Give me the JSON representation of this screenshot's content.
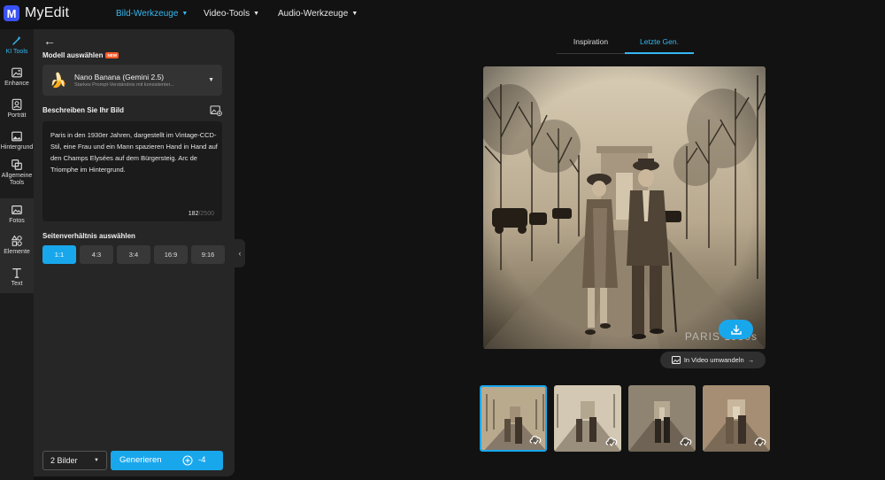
{
  "app": {
    "name": "MyEdit"
  },
  "top_nav": [
    {
      "label": "Bild-Werkzeuge",
      "active": true
    },
    {
      "label": "Video-Tools",
      "active": false
    },
    {
      "label": "Audio-Werkzeuge",
      "active": false
    }
  ],
  "rail": {
    "items": [
      {
        "label": "KI Tools",
        "icon": "magic-wand-icon",
        "active": true
      },
      {
        "label": "Enhance",
        "icon": "enhance-icon"
      },
      {
        "label": "Porträt",
        "icon": "portrait-icon"
      },
      {
        "label": "Hintergrund",
        "icon": "background-icon"
      },
      {
        "label": "Allgemeine Tools",
        "icon": "general-tools-icon"
      },
      {
        "label": "Fotos",
        "icon": "photos-icon"
      },
      {
        "label": "Elemente",
        "icon": "elements-icon"
      },
      {
        "label": "Text",
        "icon": "text-icon"
      }
    ]
  },
  "panel": {
    "model_heading": "Modell auswählen",
    "new_badge": "NEW",
    "model": {
      "name": "Nano Banana (Gemini 2.5)",
      "description": "Starkes Prompt-Verständnis mit konsistenter..."
    },
    "prompt_heading": "Beschreiben Sie Ihr Bild",
    "prompt_text": "Paris in den 1930er Jahren, dargestellt im Vintage-CCD-Stil, eine Frau und ein Mann spazieren Hand in Hand auf den Champs Elysées auf dem Bürgersteig. Arc de Triomphe im Hintergrund.",
    "char_count": "182",
    "char_max": "/2500",
    "ratio_heading": "Seitenverhältnis auswählen",
    "ratios": [
      {
        "label": "1:1",
        "active": true
      },
      {
        "label": "4:3"
      },
      {
        "label": "3:4"
      },
      {
        "label": "16:9"
      },
      {
        "label": "9:16"
      }
    ],
    "image_count": "2 Bilder",
    "generate_label": "Generieren",
    "credit_cost": "-4"
  },
  "main": {
    "tabs": [
      {
        "label": "Inspiration",
        "active": false
      },
      {
        "label": "Letzte Gen.",
        "active": true
      }
    ],
    "image_watermark": "PARIS 1930s",
    "video_button": "In Video umwandeln",
    "thumbnails": 4,
    "selected_thumbnail": 1
  },
  "colors": {
    "accent": "#19a7ec",
    "link_active": "#35b8f2",
    "background": "#121212",
    "panel": "#262626"
  }
}
